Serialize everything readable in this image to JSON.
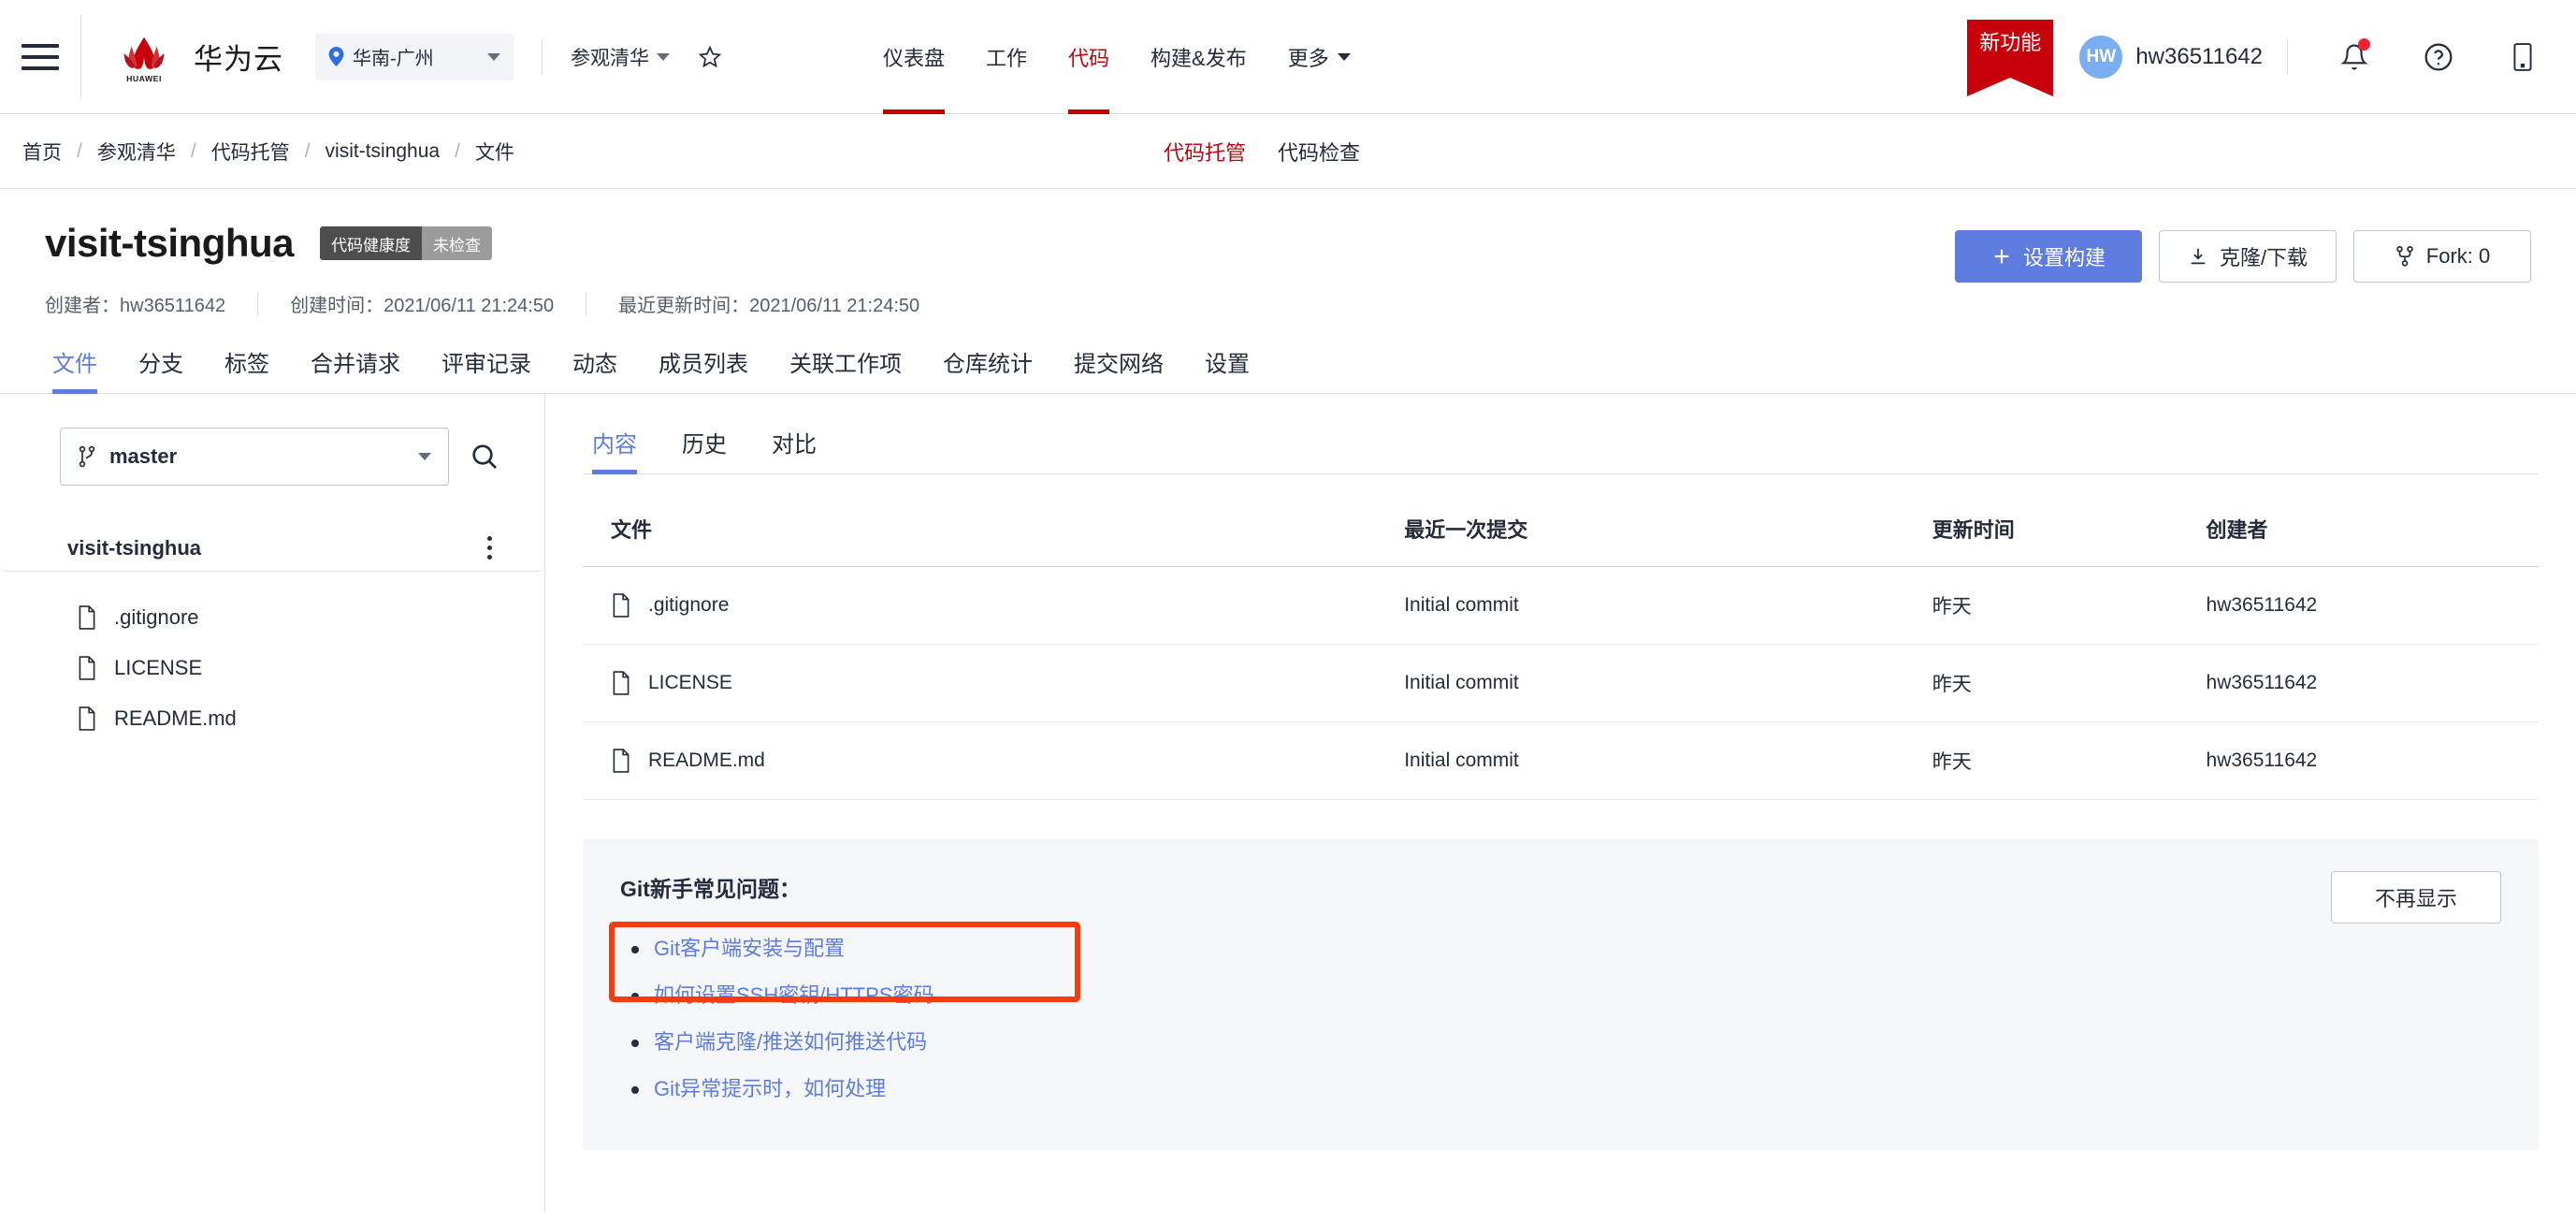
{
  "header": {
    "brand_name": "华为云",
    "region": "华南-广州",
    "project_switcher": "参观清华",
    "nav_items": [
      {
        "label": "仪表盘",
        "active": false,
        "caret": false
      },
      {
        "label": "工作",
        "active": false,
        "caret": false
      },
      {
        "label": "代码",
        "active": true,
        "caret": false
      },
      {
        "label": "构建&发布",
        "active": false,
        "caret": false
      },
      {
        "label": "更多",
        "active": false,
        "caret": true
      }
    ],
    "new_feature_badge": "新功能",
    "avatar_initials": "HW",
    "user_name": "hw36511642",
    "icons": [
      "bell-icon",
      "help-icon",
      "mobile-icon"
    ],
    "colors": {
      "accent_red": "#c7000b",
      "accent_blue": "#5e7ce0"
    }
  },
  "breadcrumb": {
    "items": [
      "首页",
      "参观清华",
      "代码托管",
      "visit-tsinghua",
      "文件"
    ],
    "separator": "/",
    "tabs": [
      {
        "label": "代码托管",
        "active": true
      },
      {
        "label": "代码检查",
        "active": false
      }
    ]
  },
  "repo": {
    "title": "visit-tsinghua",
    "health_badge_label": "代码健康度",
    "health_badge_value": "未检查",
    "meta": [
      "创建者：hw36511642",
      "创建时间：2021/06/11 21:24:50",
      "最近更新时间：2021/06/11 21:24:50"
    ],
    "actions": [
      {
        "label": "设置构建",
        "icon": "plus-icon",
        "style": "primary"
      },
      {
        "label": "克隆/下载",
        "icon": "download-icon",
        "style": "default"
      },
      {
        "label": "Fork: 0",
        "icon": "fork-icon",
        "style": "default"
      }
    ],
    "tabs": [
      {
        "label": "文件",
        "active": true
      },
      {
        "label": "分支",
        "active": false
      },
      {
        "label": "标签",
        "active": false
      },
      {
        "label": "合并请求",
        "active": false
      },
      {
        "label": "评审记录",
        "active": false
      },
      {
        "label": "动态",
        "active": false
      },
      {
        "label": "成员列表",
        "active": false
      },
      {
        "label": "关联工作项",
        "active": false
      },
      {
        "label": "仓库统计",
        "active": false
      },
      {
        "label": "提交网络",
        "active": false
      },
      {
        "label": "设置",
        "active": false
      }
    ]
  },
  "sidebar": {
    "branch": "master",
    "tree_root": "visit-tsinghua",
    "files": [
      ".gitignore",
      "LICENSE",
      "README.md"
    ]
  },
  "content": {
    "tabs": [
      {
        "label": "内容",
        "active": true
      },
      {
        "label": "历史",
        "active": false
      },
      {
        "label": "对比",
        "active": false
      }
    ],
    "table": {
      "headers": [
        "文件",
        "最近一次提交",
        "更新时间",
        "创建者"
      ],
      "rows": [
        {
          "file": ".gitignore",
          "commit": "Initial commit",
          "updated": "昨天",
          "author": "hw36511642"
        },
        {
          "file": "LICENSE",
          "commit": "Initial commit",
          "updated": "昨天",
          "author": "hw36511642"
        },
        {
          "file": "README.md",
          "commit": "Initial commit",
          "updated": "昨天",
          "author": "hw36511642"
        }
      ]
    },
    "faq": {
      "title": "Git新手常见问题：",
      "hide_button": "不再显示",
      "links": [
        "Git客户端安装与配置",
        "如何设置SSH密钥/HTTPS密码",
        "客户端克隆/推送如何推送代码",
        "Git异常提示时，如何处理"
      ],
      "annotation_color": "#f93a0e"
    }
  }
}
